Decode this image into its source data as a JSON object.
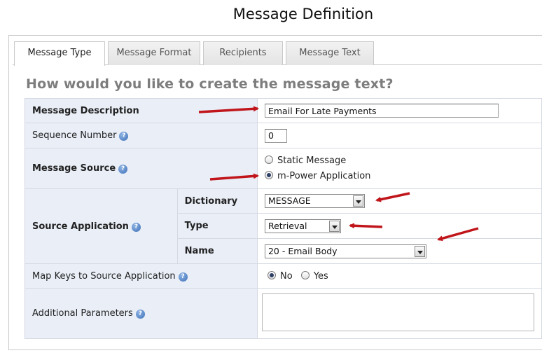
{
  "page": {
    "title": "Message Definition"
  },
  "tabs": [
    {
      "label": "Message Type",
      "active": true
    },
    {
      "label": "Message Format",
      "active": false
    },
    {
      "label": "Recipients",
      "active": false
    },
    {
      "label": "Message Text",
      "active": false
    }
  ],
  "form": {
    "heading": "How would you like to create the message text?",
    "message_description": {
      "label": "Message Description",
      "value": "Email For Late Payments"
    },
    "sequence_number": {
      "label": "Sequence Number",
      "value": "0"
    },
    "message_source": {
      "label": "Message Source",
      "options": [
        {
          "label": "Static Message",
          "checked": false
        },
        {
          "label": "m-Power Application",
          "checked": true
        }
      ]
    },
    "source_application": {
      "label": "Source Application",
      "dictionary": {
        "label": "Dictionary",
        "value": "MESSAGE"
      },
      "type": {
        "label": "Type",
        "value": "Retrieval"
      },
      "name": {
        "label": "Name",
        "value": "20 - Email Body"
      }
    },
    "map_keys": {
      "label": "Map Keys to Source Application",
      "options": [
        {
          "label": "No",
          "checked": true
        },
        {
          "label": "Yes",
          "checked": false
        }
      ]
    },
    "additional_parameters": {
      "label": "Additional Parameters",
      "value": ""
    }
  },
  "help_icon_glyph": "?",
  "annotation_arrow_color": "#c0161b"
}
